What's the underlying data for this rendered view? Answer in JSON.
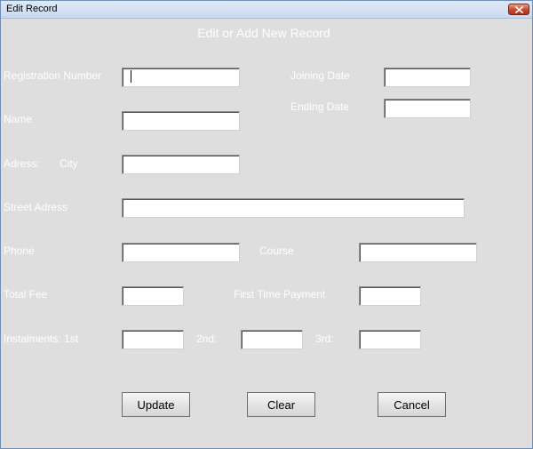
{
  "window": {
    "title": "Edit Record",
    "close_icon": "close-icon"
  },
  "heading": "Edit or Add New Record",
  "labels": {
    "registration_number": "Registration Number",
    "joining_date": "Joining Date",
    "name": "Name",
    "ending_date": "Ending Date",
    "adress": "Adress:",
    "city": "City",
    "street_adress": "Street Adress",
    "phone": "Phone",
    "course": "Course",
    "total_fee": "Total Fee",
    "first_time_payment": "First Time Payment",
    "instalments_1st": "Instalments: 1st",
    "instalments_2nd": "2nd:",
    "instalments_3rd": "3rd:"
  },
  "fields": {
    "registration_number": "",
    "joining_date": "",
    "name": "",
    "ending_date": "",
    "city": "",
    "street_adress": "",
    "phone": "",
    "course": "",
    "total_fee": "",
    "first_time_payment": "",
    "instalment_1st": "",
    "instalment_2nd": "",
    "instalment_3rd": ""
  },
  "buttons": {
    "update": "Update",
    "clear": "Clear",
    "cancel": "Cancel"
  },
  "colors": {
    "background": "#dedede",
    "label_text": "#ffffff",
    "titlebar": "#c9daef",
    "close": "#c9462a"
  }
}
